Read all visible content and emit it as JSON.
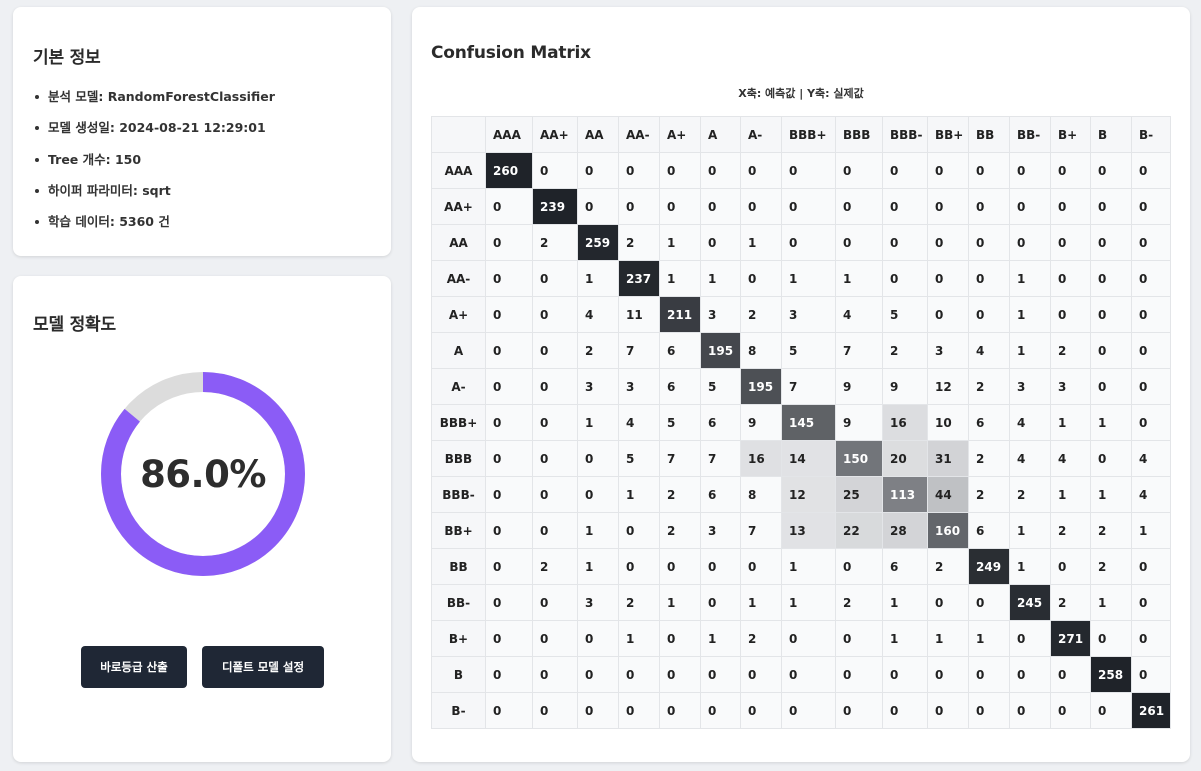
{
  "info": {
    "title": "기본 정보",
    "items": [
      "분석 모델: RandomForestClassifier",
      "모델 생성일: 2024-08-21 12:29:01",
      "Tree 개수: 150",
      "하이퍼 파라미터: sqrt",
      "학습 데이터: 5360 건"
    ]
  },
  "accuracy": {
    "title": "모델 정확도",
    "value_text": "86.0%",
    "value": 86.0,
    "ring_color": "#8b5cf6",
    "track_color": "#dcdcdc"
  },
  "buttons": {
    "calc_label": "바로등급 산출",
    "default_label": "디폴트 모델 설정"
  },
  "matrix": {
    "title": "Confusion Matrix",
    "axis_note": "X축: 예측값 | Y축: 실제값",
    "labels": [
      "AAA",
      "AA+",
      "AA",
      "AA-",
      "A+",
      "A",
      "A-",
      "BBB+",
      "BBB",
      "BBB-",
      "BB+",
      "BB",
      "BB-",
      "B+",
      "B",
      "B-"
    ],
    "rows": [
      [
        260,
        0,
        0,
        0,
        0,
        0,
        0,
        0,
        0,
        0,
        0,
        0,
        0,
        0,
        0,
        0
      ],
      [
        0,
        239,
        0,
        0,
        0,
        0,
        0,
        0,
        0,
        0,
        0,
        0,
        0,
        0,
        0,
        0
      ],
      [
        0,
        2,
        259,
        2,
        1,
        0,
        1,
        0,
        0,
        0,
        0,
        0,
        0,
        0,
        0,
        0
      ],
      [
        0,
        0,
        1,
        237,
        1,
        1,
        0,
        1,
        1,
        0,
        0,
        0,
        1,
        0,
        0,
        0
      ],
      [
        0,
        0,
        4,
        11,
        211,
        3,
        2,
        3,
        4,
        5,
        0,
        0,
        1,
        0,
        0,
        0
      ],
      [
        0,
        0,
        2,
        7,
        6,
        195,
        8,
        5,
        7,
        2,
        3,
        4,
        1,
        2,
        0,
        0
      ],
      [
        0,
        0,
        3,
        3,
        6,
        5,
        195,
        7,
        9,
        9,
        12,
        2,
        3,
        3,
        0,
        0
      ],
      [
        0,
        0,
        1,
        4,
        5,
        6,
        9,
        145,
        9,
        16,
        10,
        6,
        4,
        1,
        1,
        0
      ],
      [
        0,
        0,
        0,
        5,
        7,
        7,
        16,
        14,
        150,
        20,
        31,
        2,
        4,
        4,
        0,
        4
      ],
      [
        0,
        0,
        0,
        1,
        2,
        6,
        8,
        12,
        25,
        113,
        44,
        2,
        2,
        1,
        1,
        4
      ],
      [
        0,
        0,
        1,
        0,
        2,
        3,
        7,
        13,
        22,
        28,
        160,
        6,
        1,
        2,
        2,
        1
      ],
      [
        0,
        2,
        1,
        0,
        0,
        0,
        0,
        1,
        0,
        6,
        2,
        249,
        1,
        0,
        2,
        0
      ],
      [
        0,
        0,
        3,
        2,
        1,
        0,
        1,
        1,
        2,
        1,
        0,
        0,
        245,
        2,
        1,
        0
      ],
      [
        0,
        0,
        0,
        1,
        0,
        1,
        2,
        0,
        0,
        1,
        1,
        1,
        0,
        271,
        0,
        0
      ],
      [
        0,
        0,
        0,
        0,
        0,
        0,
        0,
        0,
        0,
        0,
        0,
        0,
        0,
        0,
        258,
        0
      ],
      [
        0,
        0,
        0,
        0,
        0,
        0,
        0,
        0,
        0,
        0,
        0,
        0,
        0,
        0,
        0,
        261
      ]
    ]
  }
}
